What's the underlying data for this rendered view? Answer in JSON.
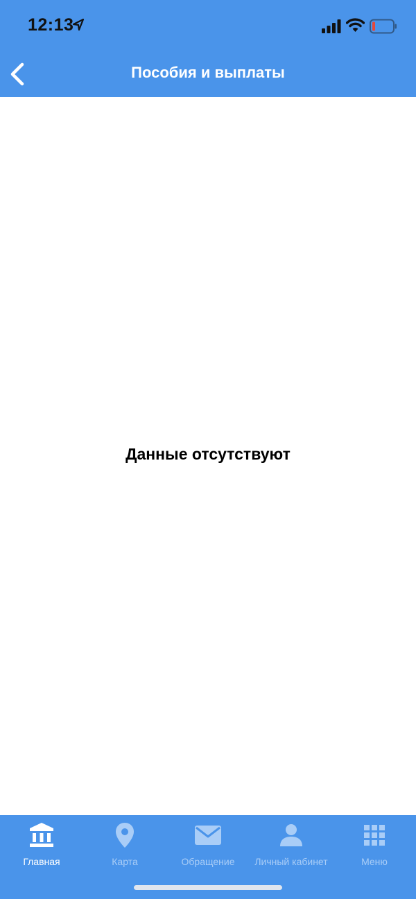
{
  "status_bar": {
    "time": "12:13"
  },
  "header": {
    "title": "Пособия и выплаты"
  },
  "content": {
    "empty_message": "Данные отсутствуют"
  },
  "tabbar": {
    "tabs": [
      {
        "label": "Главная",
        "icon": "bank-icon",
        "active": true
      },
      {
        "label": "Карта",
        "icon": "map-pin-icon",
        "active": false
      },
      {
        "label": "Обращение",
        "icon": "envelope-icon",
        "active": false
      },
      {
        "label": "Личный кабинет",
        "icon": "user-icon",
        "active": false
      },
      {
        "label": "Меню",
        "icon": "grid-icon",
        "active": false
      }
    ]
  },
  "colors": {
    "brand_blue": "#4a94ea",
    "tab_inactive": "#a9cdf7",
    "battery_low": "#e5483c"
  }
}
